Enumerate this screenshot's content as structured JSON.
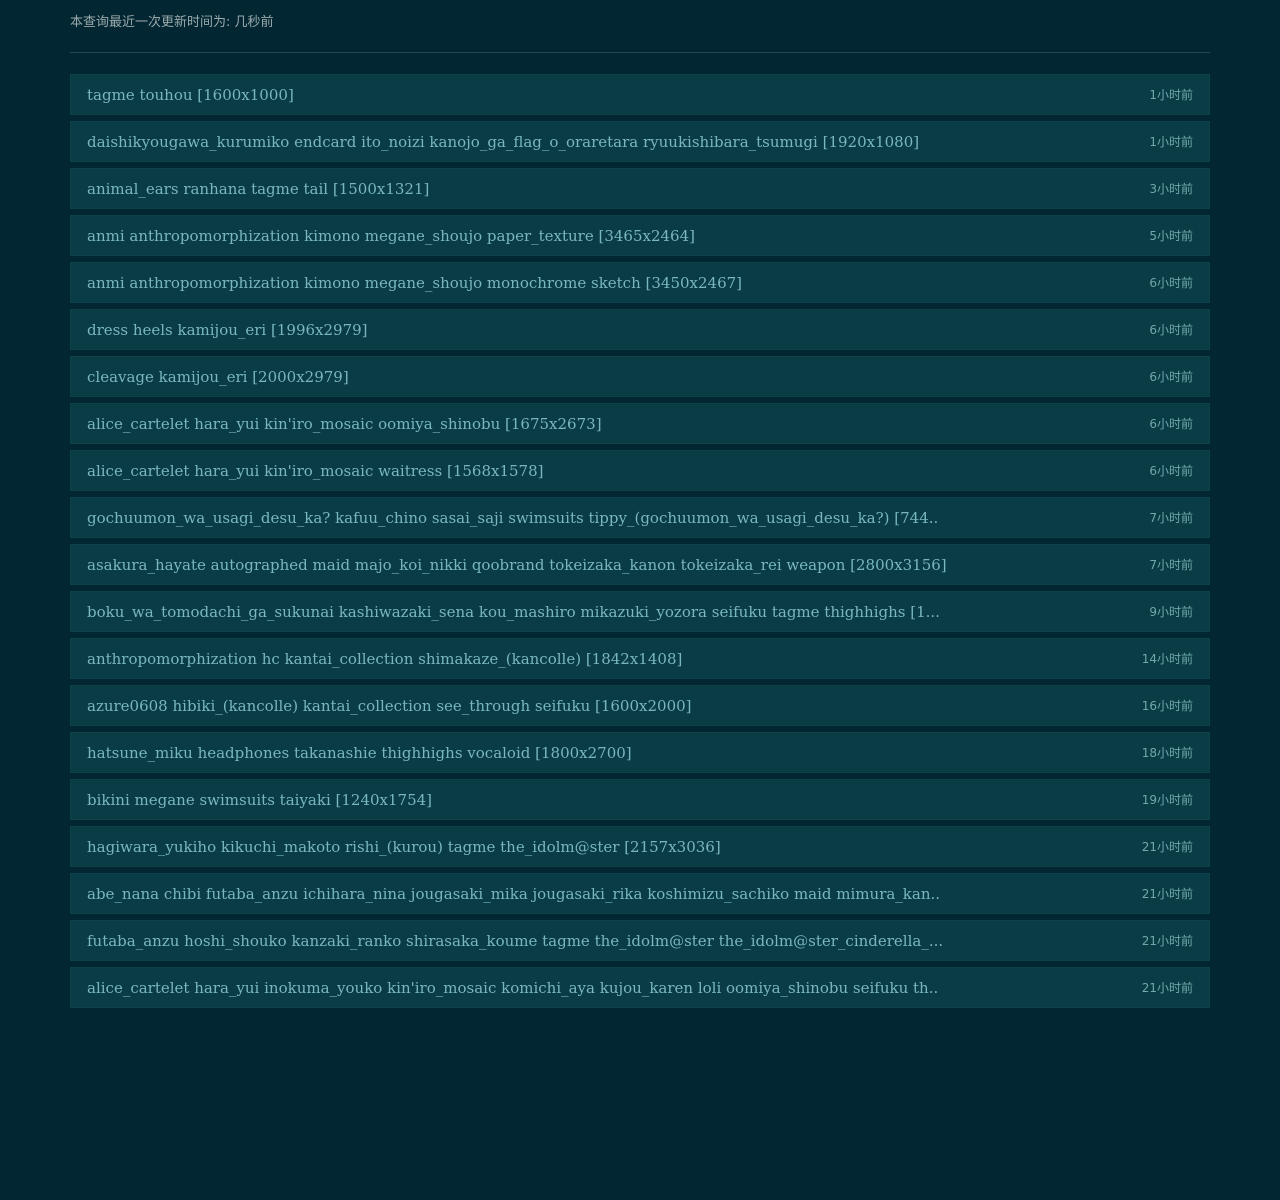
{
  "header": {
    "last_update": "本查询最近一次更新时间为: 几秒前"
  },
  "items": [
    {
      "title": "tagme touhou [1600x1000]",
      "time": "1小时前"
    },
    {
      "title": "daishikyougawa_kurumiko endcard ito_noizi kanojo_ga_flag_o_oraretara ryuukishibara_tsumugi [1920x1080]",
      "time": "1小时前"
    },
    {
      "title": "animal_ears ranhana tagme tail [1500x1321]",
      "time": "3小时前"
    },
    {
      "title": "anmi anthropomorphization kimono megane_shoujo paper_texture [3465x2464]",
      "time": "5小时前"
    },
    {
      "title": "anmi anthropomorphization kimono megane_shoujo monochrome sketch [3450x2467]",
      "time": "6小时前"
    },
    {
      "title": "dress heels kamijou_eri [1996x2979]",
      "time": "6小时前"
    },
    {
      "title": "cleavage kamijou_eri [2000x2979]",
      "time": "6小时前"
    },
    {
      "title": "alice_cartelet hara_yui kin'iro_mosaic oomiya_shinobu [1675x2673]",
      "time": "6小时前"
    },
    {
      "title": "alice_cartelet hara_yui kin'iro_mosaic waitress [1568x1578]",
      "time": "6小时前"
    },
    {
      "title": "gochuumon_wa_usagi_desu_ka? kafuu_chino sasai_saji swimsuits tippy_(gochuumon_wa_usagi_desu_ka?) [744..",
      "time": "7小时前"
    },
    {
      "title": "asakura_hayate autographed maid majo_koi_nikki qoobrand tokeizaka_kanon tokeizaka_rei weapon [2800x3156]",
      "time": "7小时前"
    },
    {
      "title": "boku_wa_tomodachi_ga_sukunai kashiwazaki_sena kou_mashiro mikazuki_yozora seifuku tagme thighhighs [1...",
      "time": "9小时前"
    },
    {
      "title": "anthropomorphization hc kantai_collection shimakaze_(kancolle) [1842x1408]",
      "time": "14小时前"
    },
    {
      "title": "azure0608 hibiki_(kancolle) kantai_collection see_through seifuku [1600x2000]",
      "time": "16小时前"
    },
    {
      "title": "hatsune_miku headphones takanashie thighhighs vocaloid [1800x2700]",
      "time": "18小时前"
    },
    {
      "title": "bikini megane swimsuits taiyaki [1240x1754]",
      "time": "19小时前"
    },
    {
      "title": "hagiwara_yukiho kikuchi_makoto rishi_(kurou) tagme the_idolm@ster [2157x3036]",
      "time": "21小时前"
    },
    {
      "title": "abe_nana chibi futaba_anzu ichihara_nina jougasaki_mika jougasaki_rika koshimizu_sachiko maid mimura_kan..",
      "time": "21小时前"
    },
    {
      "title": "futaba_anzu hoshi_shouko kanzaki_ranko shirasaka_koume tagme the_idolm@ster the_idolm@ster_cinderella_...",
      "time": "21小时前"
    },
    {
      "title": "alice_cartelet hara_yui inokuma_youko kin'iro_mosaic komichi_aya kujou_karen loli oomiya_shinobu seifuku th..",
      "time": "21小时前"
    }
  ]
}
